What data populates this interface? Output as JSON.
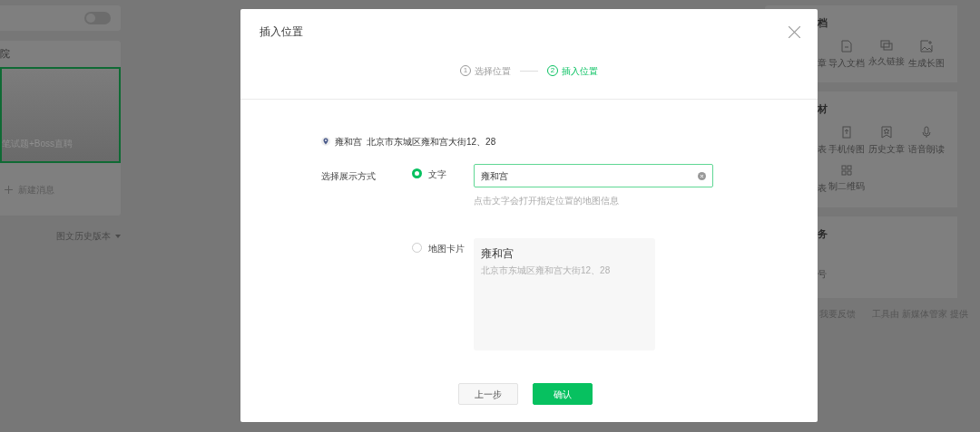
{
  "background": {
    "left_panel": {
      "toggle": {
        "on": false
      },
      "card_title": "院",
      "article_caption": "笔试题+Boss直聘",
      "new_message": "新建消息",
      "history_link": "图文历史版本"
    },
    "right_panel": {
      "sections": [
        {
          "title": "档",
          "tools": [
            {
              "kind": "none",
              "label": "章"
            },
            {
              "kind": "doc",
              "label": "导入文档"
            },
            {
              "kind": "link",
              "label": "永久链接"
            },
            {
              "kind": "image",
              "label": "生成长图"
            }
          ]
        },
        {
          "title": "材",
          "tools": [
            {
              "kind": "none",
              "label": "表"
            },
            {
              "kind": "phone",
              "label": "手机传图"
            },
            {
              "kind": "bookmark",
              "label": "历史文章"
            },
            {
              "kind": "mic",
              "label": "语音朗读"
            },
            {
              "kind": "none",
              "label": "表"
            },
            {
              "kind": "qr",
              "label": "制二维码"
            }
          ]
        },
        {
          "title": "务",
          "tools": [
            {
              "kind": "none",
              "label": "号"
            }
          ]
        }
      ],
      "footer": {
        "feedback": "我要反馈",
        "provider": "工具由 新媒体管家 提供"
      }
    }
  },
  "dialog": {
    "title": "插入位置",
    "steps": [
      {
        "number": "1",
        "label": "选择位置",
        "selected": false
      },
      {
        "number": "2",
        "label": "插入位置",
        "selected": true
      }
    ],
    "location": {
      "name": "雍和宫",
      "address": "北京市东城区雍和宫大街12、28"
    },
    "display_label": "选择展示方式",
    "options": [
      {
        "kind": "text",
        "label": "文字",
        "selected": true,
        "value": "雍和宫",
        "hint": "点击文字会打开指定位置的地图信息"
      },
      {
        "kind": "card",
        "label": "地图卡片",
        "selected": false,
        "card_title": "雍和宫",
        "card_address": "北京市东城区雍和宫大街12、28"
      }
    ],
    "buttons": [
      {
        "kind": "secondary",
        "label": "上一步"
      },
      {
        "kind": "primary",
        "label": "确认"
      }
    ]
  }
}
